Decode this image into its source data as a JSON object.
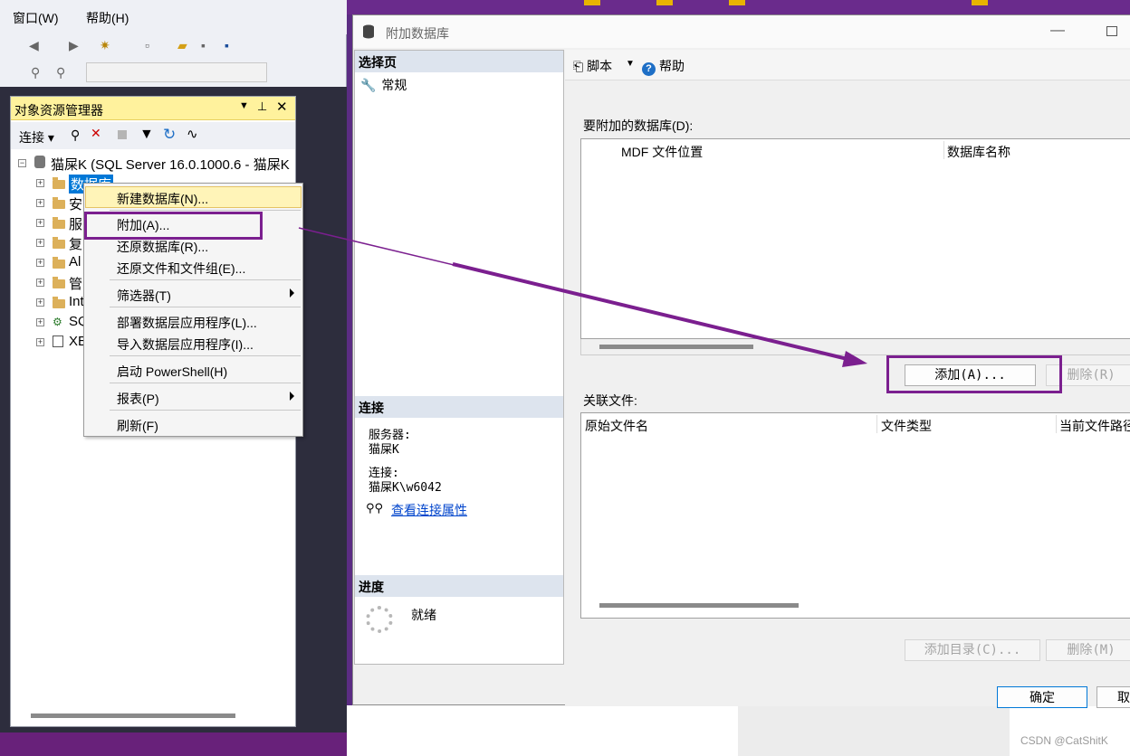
{
  "ssms": {
    "menu": {
      "window": "窗口(W)",
      "help": "帮助(H)"
    },
    "object_explorer": {
      "title": "对象资源管理器",
      "connect": "连接",
      "server_node": "猫屎K (SQL Server 16.0.1000.6 - 猫屎K",
      "nodes": [
        "数据库",
        "安",
        "服",
        "复",
        "Al",
        "管",
        "Int",
        "SQ",
        "XE"
      ]
    },
    "context_menu": {
      "items": [
        "新建数据库(N)...",
        "附加(A)...",
        "还原数据库(R)...",
        "还原文件和文件组(E)...",
        "筛选器(T)",
        "部署数据层应用程序(L)...",
        "导入数据层应用程序(I)...",
        "启动 PowerShell(H)",
        "报表(P)",
        "刷新(F)"
      ]
    }
  },
  "dialog": {
    "title": "附加数据库",
    "left": {
      "select_page": "选择页",
      "page_general": "常规",
      "connection_header": "连接",
      "server_label": "服务器:",
      "server_value": "猫屎K",
      "conn_label": "连接:",
      "conn_value": "猫屎K\\w6042",
      "view_props": "查看连接属性",
      "progress_header": "进度",
      "status": "就绪"
    },
    "toolbar": {
      "script": "脚本",
      "help": "帮助"
    },
    "attach_label": "要附加的数据库(D):",
    "grid1_headers": [
      "MDF 文件位置",
      "数据库名称"
    ],
    "add_button": "添加(A)...",
    "remove_button": "删除(R)",
    "assoc_label": "关联文件:",
    "grid2_headers": [
      "原始文件名",
      "文件类型",
      "当前文件路径"
    ],
    "add_catalog": "添加目录(C)...",
    "remove2": "删除(M)",
    "ok": "确定",
    "cancel": "取"
  },
  "watermark": "CSDN @CatShitK",
  "colors": {
    "annotation": "#7b1f8f",
    "titlebar_yellow": "#fff29d",
    "background_purple": "#5b2c83"
  }
}
